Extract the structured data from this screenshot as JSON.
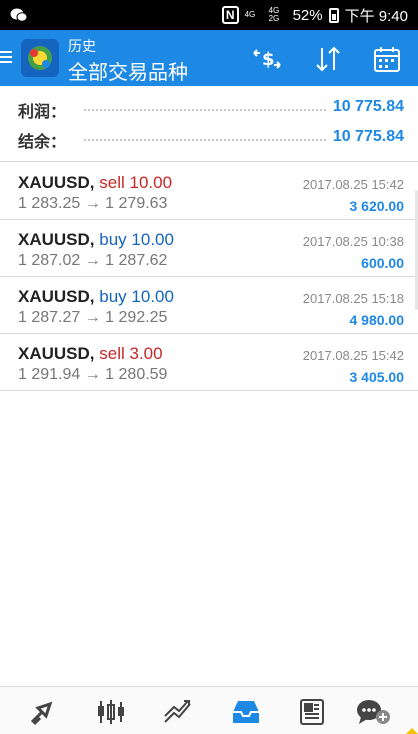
{
  "status_bar": {
    "left_icon": "wechat-icon",
    "nfc": "N",
    "net1": "4G",
    "net2": "4G 2G",
    "battery": "52%",
    "time": "下午 9:40"
  },
  "app_bar": {
    "subtitle": "历史",
    "title": "全部交易品种",
    "icons": [
      "menu-icon",
      "currency-exchange-icon",
      "sort-icon",
      "calendar-icon"
    ]
  },
  "summary": {
    "profit_label": "利润：",
    "profit_value": "10 775.84",
    "balance_label": "结余：",
    "balance_value": "10 775.84"
  },
  "trades": [
    {
      "symbol": "XAUUSD,",
      "side": "sell",
      "volume": "10.00",
      "prices": "1 283.25 → 1 279.63",
      "date": "2017.08.25 15:42",
      "profit": "3 620.00"
    },
    {
      "symbol": "XAUUSD,",
      "side": "buy",
      "volume": "10.00",
      "prices": "1 287.02 → 1 287.62",
      "date": "2017.08.25 10:38",
      "profit": "600.00"
    },
    {
      "symbol": "XAUUSD,",
      "side": "buy",
      "volume": "10.00",
      "prices": "1 287.27 → 1 292.25",
      "date": "2017.08.25 15:18",
      "profit": "4 980.00"
    },
    {
      "symbol": "XAUUSD,",
      "side": "sell",
      "volume": "3.00",
      "prices": "1 291.94 → 1 280.59",
      "date": "2017.08.25 15:42",
      "profit": "3 405.00"
    }
  ],
  "bottom_nav": [
    "quotes-icon",
    "chart-candles-icon",
    "trade-icon",
    "history-inbox-icon",
    "news-icon",
    "chat-icon"
  ],
  "colors": {
    "accent": "#1e88e5",
    "sell": "#c62828",
    "buy": "#1565c0"
  }
}
